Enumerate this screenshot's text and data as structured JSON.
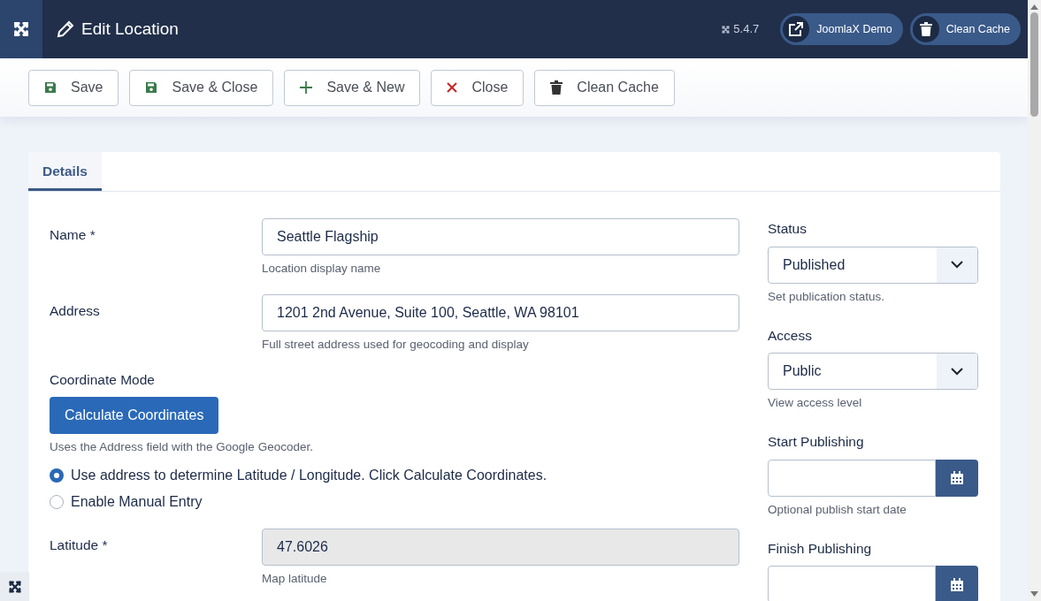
{
  "header": {
    "title": "Edit Location",
    "version": "5.4.7",
    "buttons": [
      {
        "label": "JoomlaX Demo",
        "kind": "link"
      },
      {
        "label": "Clean Cache",
        "kind": "trash"
      }
    ]
  },
  "toolbar": [
    {
      "label": "Save",
      "kind": "save"
    },
    {
      "label": "Save & Close",
      "kind": "save"
    },
    {
      "label": "Save & New",
      "kind": "new"
    },
    {
      "label": "Close",
      "kind": "close"
    },
    {
      "label": "Clean Cache",
      "kind": "trash"
    }
  ],
  "tabs": [
    {
      "label": "Details",
      "selected": true
    }
  ],
  "main_fields": [
    {
      "kind": "text",
      "label": "Name *",
      "value": "Seattle Flagship",
      "help": "Location display name",
      "disabled": false
    },
    {
      "kind": "text",
      "label": "Address",
      "value": "1201 2nd Avenue, Suite 100, Seattle, WA 98101",
      "help": "Full street address used for geocoding and display",
      "disabled": false
    },
    {
      "kind": "mode",
      "label": "Coordinate Mode",
      "button": "Calculate Coordinates",
      "help": "Uses the Address field with the Google Geocoder.",
      "options": [
        {
          "label": "Use address to determine Latitude / Longitude. Click Calculate Coordinates.",
          "selected": true
        },
        {
          "label": "Enable Manual Entry",
          "selected": false
        }
      ]
    },
    {
      "kind": "text",
      "label": "Latitude *",
      "value": "47.6026",
      "help": "Map latitude",
      "disabled": true
    }
  ],
  "side_fields": [
    {
      "kind": "select",
      "label": "Status",
      "value": "Published",
      "help": "Set publication status."
    },
    {
      "kind": "select",
      "label": "Access",
      "value": "Public",
      "help": "View access level"
    },
    {
      "kind": "date",
      "label": "Start Publishing",
      "help": "Optional publish start date"
    },
    {
      "kind": "date",
      "label": "Finish Publishing"
    }
  ]
}
